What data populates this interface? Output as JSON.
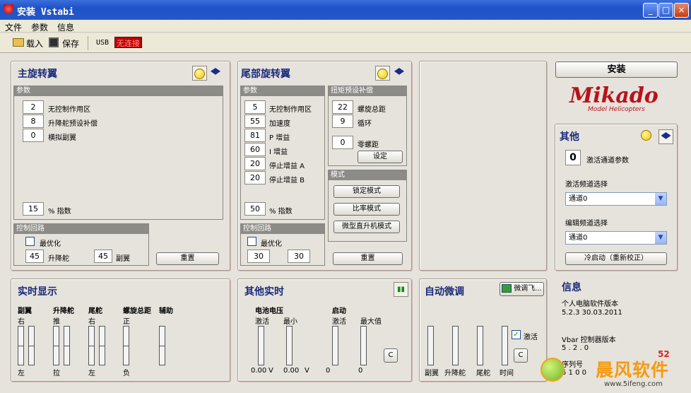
{
  "window": {
    "title": "安装 Vstabi",
    "min": "_",
    "max": "□",
    "close": "×"
  },
  "menu": [
    "文件",
    "参数",
    "信息"
  ],
  "toolbar": {
    "load": "载入",
    "save": "保存",
    "usb": "USB",
    "status": "无连接"
  },
  "main_rotor": {
    "title": "主旋转翼",
    "params_header": "参数",
    "params": [
      {
        "v": "2",
        "l": "无控制作用区"
      },
      {
        "v": "8",
        "l": "升降舵预设补偿"
      },
      {
        "v": "0",
        "l": "横拟副翼"
      }
    ],
    "expo_v": "15",
    "expo_l": "% 指数",
    "loop_header": "控制回路",
    "optimize": "最优化",
    "elev_v": "45",
    "elev_l": "升降舵",
    "ail_v": "45",
    "ail_l": "副翼",
    "reset": "重置"
  },
  "tail_rotor": {
    "title": "尾部旋转翼",
    "params_header": "参数",
    "params": [
      {
        "v": "5",
        "l": "无控制作用区"
      },
      {
        "v": "55",
        "l": "加速度"
      },
      {
        "v": "81",
        "l": "P 增益"
      },
      {
        "v": "60",
        "l": "I 增益"
      },
      {
        "v": "20",
        "l": "停止增益 A"
      },
      {
        "v": "20",
        "l": "停止增益 B"
      }
    ],
    "expo_v": "50",
    "expo_l": "% 指数",
    "torque_header": "扭矩预设补偿",
    "torque": [
      {
        "v": "22",
        "l": "螺旋总距"
      },
      {
        "v": "9",
        "l": "循环"
      },
      {
        "v": "0",
        "l": "零螺距"
      }
    ],
    "setup": "设定",
    "mode_header": "模式",
    "modes": [
      "锁定模式",
      "比率模式",
      "微型直升机模式"
    ],
    "loop_header": "控制回路",
    "optimize": "最优化",
    "v1": "30",
    "v2": "30",
    "reset": "重置"
  },
  "right": {
    "install": "安装",
    "logo": "Mikado",
    "logo_sub": "Model Helicopters",
    "other_title": "其他",
    "activate_value": "0",
    "activate_label": "激活通道参数",
    "act_channel_label": "激活频道选择",
    "act_channel_value": "通道0",
    "edit_channel_label": "编辑频道选择",
    "edit_channel_value": "通道0",
    "cold_start": "冷启动（重新校正）"
  },
  "realtime": {
    "title": "实时显示",
    "cols": [
      "副翼",
      "升降舵",
      "尾舵",
      "螺旋总距",
      "辅助"
    ],
    "top": [
      "右",
      "推",
      "右",
      "正"
    ],
    "bottom": [
      "左",
      "拉",
      "左",
      "负"
    ]
  },
  "other_realtime": {
    "title": "其他实时",
    "battery": "电池电压",
    "startup": "启动",
    "labels": [
      "激活",
      "最小",
      "激活",
      "最大值"
    ],
    "values": [
      "0.00",
      "V",
      "0.00",
      "V",
      "0",
      "0"
    ],
    "c": "C"
  },
  "autotune": {
    "title": "自动微调",
    "btn": "微调飞...",
    "activate": "激活",
    "labels": [
      "副翼",
      "升降舵",
      "尾舵",
      "时间"
    ],
    "c": "C"
  },
  "info": {
    "title": "信息",
    "pc_label": "个人电脑软件版本",
    "pc_version": "5.2.3  30.03.2011",
    "vbar_label": "Vbar 控制器版本",
    "vbar_version": "5 . 2 . 0",
    "serial_label": "序列号",
    "serial_value": "5 1 0 0"
  },
  "watermark": {
    "text": "晨风软件",
    "url": "www.5ifeng.com",
    "badge": "52"
  },
  "colors": {
    "title_bar": "#2558c6",
    "panel_title": "#1a2a7a",
    "status_bg": "#c00000"
  }
}
